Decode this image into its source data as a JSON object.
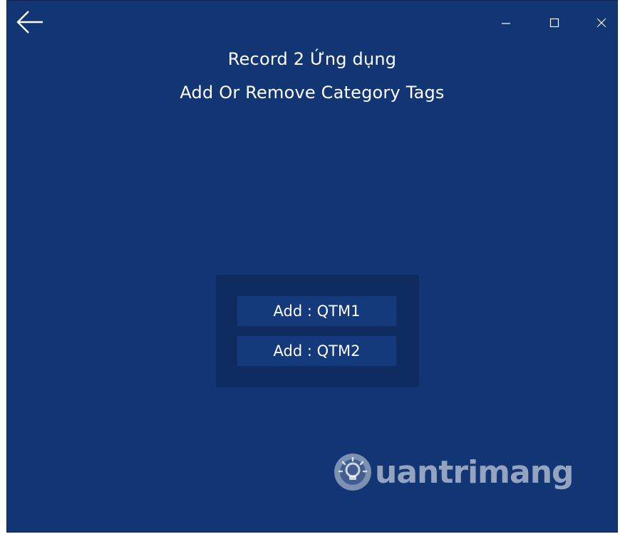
{
  "window": {
    "title_line1": "Record 2  Ứng dụng",
    "title_line2": "Add Or Remove Category Tags"
  },
  "titlebar": {
    "back_icon": "arrow-left-icon",
    "minimize_icon": "minimize-icon",
    "maximize_icon": "maximize-icon",
    "close_icon": "close-icon"
  },
  "tags": {
    "buttons": [
      {
        "label": "Add : QTM1"
      },
      {
        "label": "Add : QTM2"
      }
    ]
  },
  "watermark": {
    "text": "uantrimang",
    "icon": "lightbulb-icon"
  },
  "colors": {
    "background": "#123574",
    "panel": "#0f2c60",
    "button": "#153a7c",
    "text": "#ffffff"
  }
}
